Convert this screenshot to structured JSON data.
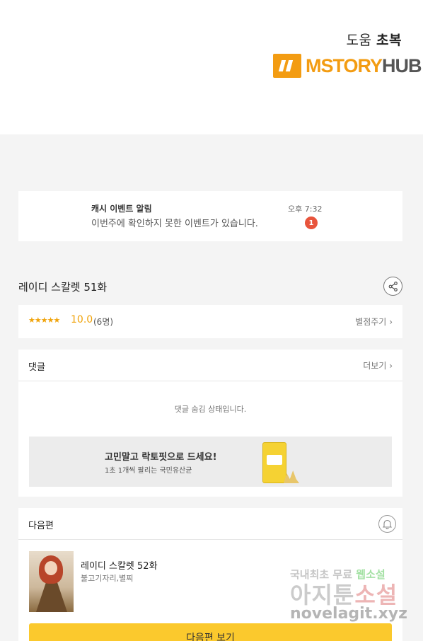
{
  "header": {
    "help_text": "도움",
    "thanks_text": "초복",
    "logo_part1": "MSTORY",
    "logo_part2": "HUB"
  },
  "notification": {
    "title": "캐시 이벤트 알림",
    "message": "이번주에 확인하지 못한 이벤트가 있습니다.",
    "time": "오후 7:32",
    "badge_count": "1"
  },
  "episode": {
    "title": "레이디 스칼렛 51화",
    "share_icon": "share-icon"
  },
  "rating": {
    "stars": "★★★★★",
    "score": "10.0",
    "count": "(6명)",
    "rate_link": "별점주기"
  },
  "comments": {
    "title": "댓글",
    "more_link": "더보기",
    "hidden_message": "댓글 숨김 상태입니다."
  },
  "ad": {
    "title": "고민말고 락토핏으로 드세요!",
    "subtitle": "1초 1개씩 팔리는 국민유산균"
  },
  "next_episode": {
    "section_title": "다음편",
    "title": "레이디 스칼렛 52화",
    "author": "불고기자리,별찌",
    "button_label": "다음편 보기"
  },
  "watermark": {
    "line1_a": "국내최초 무료",
    "line1_b": "웹소설",
    "line2_a": "아지툰",
    "line2_b": "소설",
    "line3": "novelagit.xyz"
  },
  "colors": {
    "accent": "#f39c12",
    "rating": "#f0a30a",
    "badge": "#e8543c",
    "button": "#fbc92d"
  }
}
